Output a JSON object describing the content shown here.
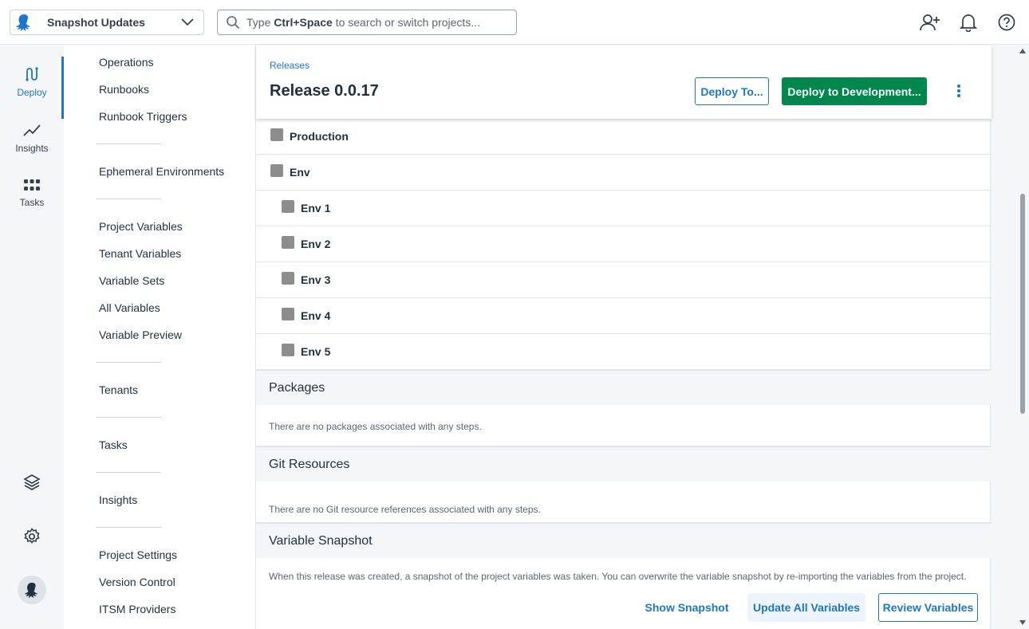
{
  "topbar": {
    "project_name": "Snapshot Updates",
    "search_prefix": "Type",
    "search_key": "Ctrl+Space",
    "search_suffix": "to search or switch projects..."
  },
  "rail": {
    "deploy": "Deploy",
    "insights": "Insights",
    "tasks": "Tasks"
  },
  "sidenav": {
    "operations": "Operations",
    "runbooks": "Runbooks",
    "runbook_triggers": "Runbook Triggers",
    "ephemeral": "Ephemeral Environments",
    "project_variables": "Project Variables",
    "tenant_variables": "Tenant Variables",
    "variable_sets": "Variable Sets",
    "all_variables": "All Variables",
    "variable_preview": "Variable Preview",
    "tenants": "Tenants",
    "tasks": "Tasks",
    "insights": "Insights",
    "project_settings": "Project Settings",
    "version_control": "Version Control",
    "itsm": "ITSM Providers"
  },
  "header": {
    "breadcrumb": "Releases",
    "title": "Release 0.0.17",
    "deploy_to": "Deploy To...",
    "deploy_dev": "Deploy to Development..."
  },
  "environments": [
    {
      "label": "Production"
    },
    {
      "label": "Env"
    },
    {
      "label": "Env 1"
    },
    {
      "label": "Env 2"
    },
    {
      "label": "Env 3"
    },
    {
      "label": "Env 4"
    },
    {
      "label": "Env 5"
    }
  ],
  "packages": {
    "title": "Packages",
    "empty": "There are no packages associated with any steps."
  },
  "git": {
    "title": "Git Resources",
    "empty": "There are no Git resource references associated with any steps."
  },
  "snapshot": {
    "title": "Variable Snapshot",
    "description": "When this release was created, a snapshot of the project variables was taken. You can overwrite the variable snapshot by re-importing the variables from the project.",
    "show": "Show Snapshot",
    "update": "Update All Variables",
    "review": "Review Variables"
  },
  "colors": {
    "accent": "#1a77ca",
    "deploy_green": "#00874d",
    "env_box": "#8d8d8d"
  }
}
